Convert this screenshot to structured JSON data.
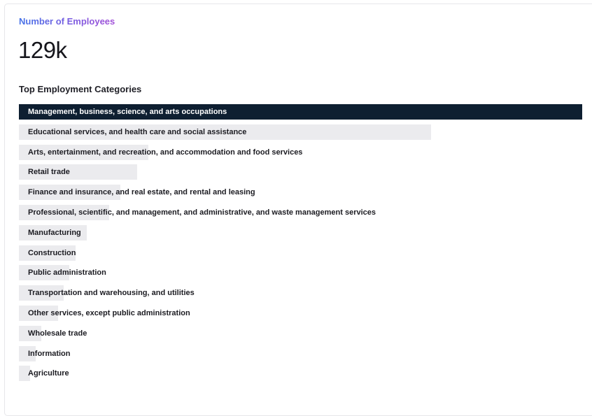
{
  "metric": {
    "label": "Number of Employees",
    "value": "129k"
  },
  "colors": {
    "top_bar": "#0e1f31",
    "bar": "#ebebee",
    "label_gradient_start": "#4573e8",
    "label_gradient_end": "#a24fd8"
  },
  "chart_data": {
    "type": "bar",
    "orientation": "horizontal",
    "title": "Top Employment Categories",
    "categories": [
      "Management, business, science, and arts occupations",
      "Educational services, and health care and social assistance",
      "Arts, entertainment, and recreation, and accommodation and food services",
      "Retail trade",
      "Finance and insurance, and real estate, and rental and leasing",
      "Professional, scientific, and management, and administrative, and waste management services",
      "Manufacturing",
      "Construction",
      "Public administration",
      "Transportation and warehousing, and utilities",
      "Other services, except public administration",
      "Wholesale trade",
      "Information",
      "Agriculture"
    ],
    "values": [
      100,
      73.2,
      23,
      21,
      18,
      16,
      12,
      10,
      9,
      8,
      7,
      4,
      3,
      2
    ],
    "value_unit": "percent of largest category",
    "xlim": [
      0,
      100
    ]
  }
}
